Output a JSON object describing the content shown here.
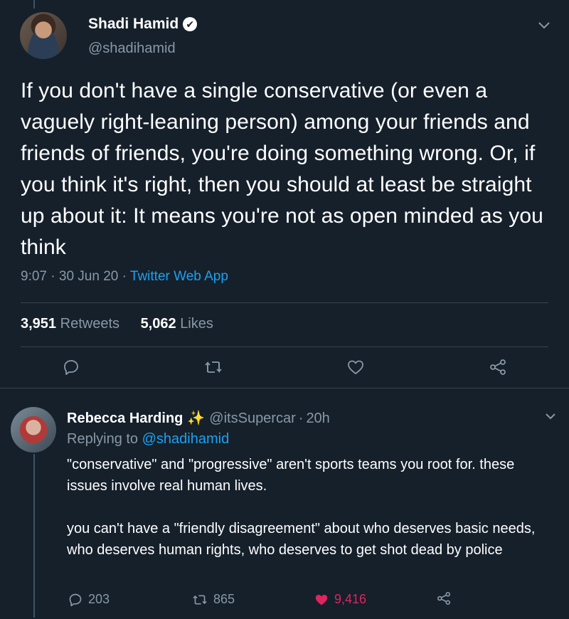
{
  "main_tweet": {
    "author_name": "Shadi Hamid",
    "verified_mark": "✔",
    "handle": "@shadihamid",
    "text": "If you don't have a single conservative (or even a vaguely right-leaning person) among your friends and friends of friends, you're doing something wrong. Or, if you think it's right, then you should at least be straight up about it: It means you're not as open minded as you think",
    "time": "9:07",
    "date": "30 Jun 20",
    "source": "Twitter Web App",
    "retweets_count": "3,951",
    "retweets_label": "Retweets",
    "likes_count": "5,062",
    "likes_label": "Likes",
    "icons": [
      "reply-icon",
      "retweet-icon",
      "like-icon",
      "share-icon",
      "chevron-down-icon"
    ]
  },
  "reply_tweet": {
    "author_name": "Rebecca Harding",
    "emoji": "✨",
    "handle": "@itsSupercar",
    "age": "20h",
    "replying_label": "Replying to",
    "replying_handle": "@shadihamid",
    "text_para1": "\"conservative\" and \"progressive\" aren't sports teams you root for. these issues involve real human lives.",
    "text_para2": "you can't have a \"friendly disagreement\" about who deserves basic needs, who deserves human rights, who deserves to get shot dead by police",
    "reply_count": "203",
    "retweet_count": "865",
    "like_count": "9,416",
    "liked": true
  },
  "colors": {
    "background": "#15202b",
    "secondary_text": "#8899a6",
    "link": "#1da1f2",
    "like": "#e0245e",
    "divider": "#38444d"
  }
}
